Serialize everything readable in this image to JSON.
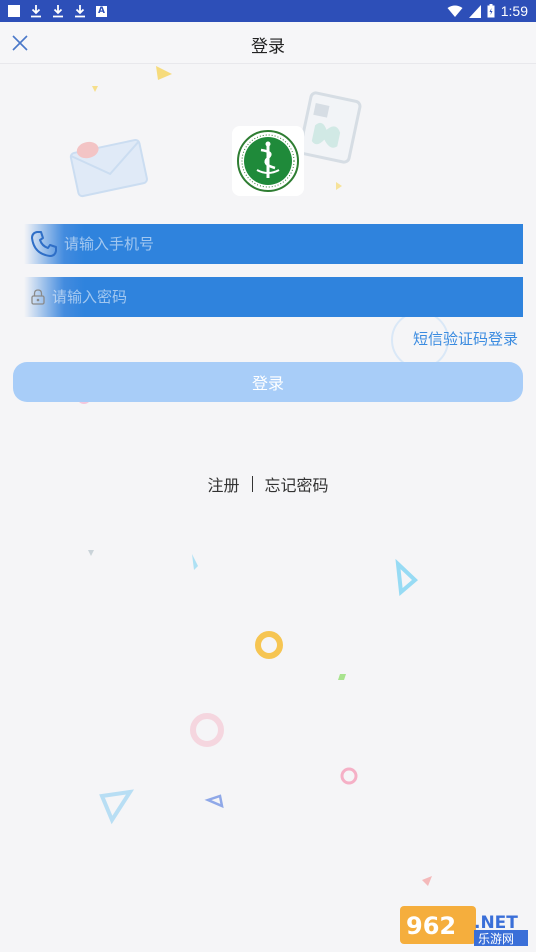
{
  "status_bar": {
    "time": "1:59",
    "background": "#2d4fb8"
  },
  "header": {
    "title": "登录",
    "close_icon": "close-icon"
  },
  "phone_input": {
    "placeholder": "请输入手机号",
    "value": "",
    "icon": "phone-icon"
  },
  "password_input": {
    "placeholder": "请输入密码",
    "value": "",
    "icon": "lock-icon"
  },
  "sms_login_link": "短信验证码登录",
  "login_button": "登录",
  "links": {
    "register": "注册",
    "forgot_password": "忘记密码"
  },
  "watermark": {
    "number": "962",
    "suffix": ".NET",
    "subtitle": "乐游网"
  },
  "colors": {
    "accent": "#2f83dd",
    "button": "#a8cdf8",
    "link": "#3a8be0"
  }
}
